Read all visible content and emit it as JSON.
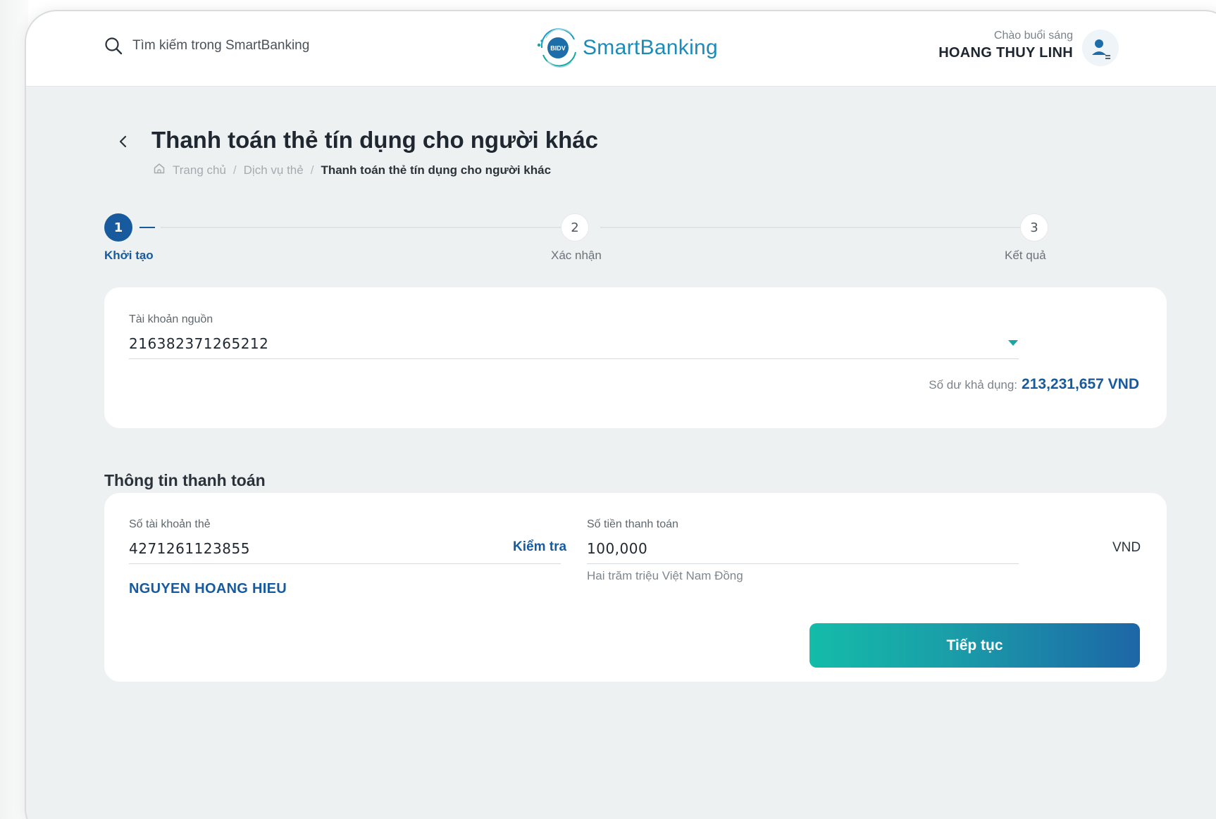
{
  "header": {
    "search_placeholder": "Tìm kiếm trong SmartBanking",
    "logo_badge": "BIDV",
    "logo_text": "SmartBanking",
    "greeting": "Chào buổi sáng",
    "username": "HOANG THUY LINH"
  },
  "page": {
    "title": "Thanh toán thẻ tín dụng cho người khác",
    "breadcrumb": {
      "home": "Trang chủ",
      "separator": "/",
      "section": "Dịch vụ thẻ",
      "current": "Thanh toán thẻ tín dụng cho người khác"
    }
  },
  "stepper": {
    "steps": [
      {
        "number": "1",
        "label": "Khởi tạo",
        "state": "active"
      },
      {
        "number": "2",
        "label": "Xác nhận",
        "state": "idle"
      },
      {
        "number": "3",
        "label": "Kết quả",
        "state": "idle"
      }
    ]
  },
  "source_account": {
    "label": "Tài khoản nguồn",
    "value": "216382371265212",
    "balance_label": "Số dư khả dụng:",
    "balance_value": "213,231,657 VND"
  },
  "payment": {
    "section_title": "Thông tin thanh toán",
    "card_account_label": "Số tài khoản thẻ",
    "card_account_value": "4271261123855",
    "check_label": "Kiểm tra",
    "owner_name": "NGUYEN HOANG HIEU",
    "amount_label": "Số tiền thanh toán",
    "amount_value": "100,000",
    "currency": "VND",
    "amount_in_words": "Hai trăm triệu Việt Nam Đồng",
    "continue_label": "Tiếp tục"
  },
  "colors": {
    "primary": "#175a9e",
    "accent": "#17a7a0",
    "background": "#eef1f1",
    "card": "#ffffff"
  },
  "icons": {
    "search": "search-icon",
    "back": "chevron-left-icon",
    "home": "home-icon",
    "dropdown": "caret-down-icon",
    "avatar": "user-icon"
  }
}
